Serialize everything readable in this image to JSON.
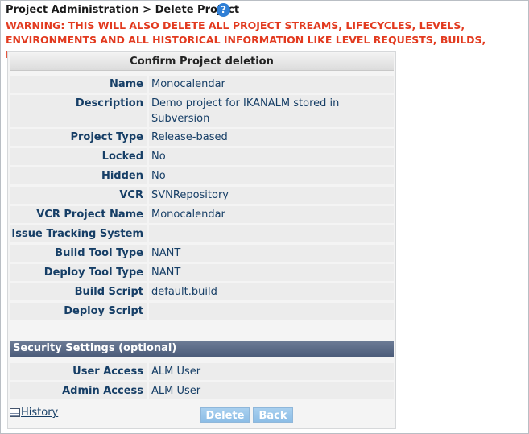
{
  "breadcrumb": "Project Administration > Delete Project",
  "help_icon": "question-mark-icon",
  "warning": "WARNING: THIS WILL ALSO DELETE ALL PROJECT STREAMS, LIFECYCLES, LEVELS, ENVIRONMENTS AND ALL HISTORICAL INFORMATION LIKE LEVEL REQUESTS, BUILDS, DEPLOYS, ETC...",
  "panel": {
    "title": "Confirm Project deletion",
    "fields": [
      {
        "label": "Name",
        "value": "Monocalendar"
      },
      {
        "label": "Description",
        "value": "Demo project for IKANALM stored in Subversion"
      },
      {
        "label": "Project Type",
        "value": "Release-based"
      },
      {
        "label": "Locked",
        "value": "No"
      },
      {
        "label": "Hidden",
        "value": "No"
      },
      {
        "label": "VCR",
        "value": "SVNRepository"
      },
      {
        "label": "VCR Project Name",
        "value": "Monocalendar"
      },
      {
        "label": "Issue Tracking System",
        "value": ""
      },
      {
        "label": "Build Tool Type",
        "value": "NANT"
      },
      {
        "label": "Deploy Tool Type",
        "value": "NANT"
      },
      {
        "label": "Build Script",
        "value": "default.build"
      },
      {
        "label": "Deploy Script",
        "value": ""
      }
    ],
    "security_title": "Security Settings (optional)",
    "security": [
      {
        "label": "User Access",
        "value": "ALM User"
      },
      {
        "label": "Admin Access",
        "value": "ALM User"
      }
    ]
  },
  "footer": {
    "history_label": "History",
    "delete_label": "Delete",
    "back_label": "Back"
  },
  "colors": {
    "warning": "#e23a1f",
    "label_text": "#163e66",
    "section_header": "#53627f",
    "button": "#9ac7ec"
  }
}
